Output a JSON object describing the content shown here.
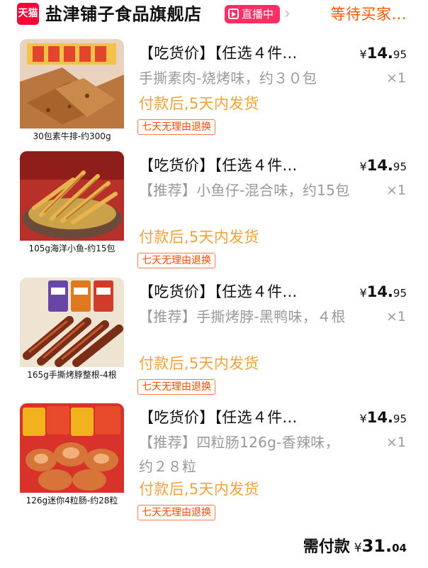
{
  "header": {
    "logo_text": "天猫",
    "store_name": "盐津铺子食品旗舰店",
    "live_label": "直播中",
    "chevron": "›",
    "status": "等待买家..."
  },
  "items": [
    {
      "title": "【吃货价】【任选４件...",
      "price_currency": "¥",
      "price_int": "14.",
      "price_dec": "95",
      "sku": "手撕素肉-烧烤味，约３０包",
      "qty": "×1",
      "ship": "付款后,5天内发货",
      "tag": "七天无理由退换",
      "image_caption": "30包素牛排-约300g"
    },
    {
      "title": "【吃货价】【任选４件...",
      "price_currency": "¥",
      "price_int": "14.",
      "price_dec": "95",
      "sku": "【推荐】小鱼仔-混合味，约15包",
      "qty": "×1",
      "ship": "付款后,5天内发货",
      "tag": "七天无理由退换",
      "image_caption": "105g海洋小鱼-约15包"
    },
    {
      "title": "【吃货价】【任选４件...",
      "price_currency": "¥",
      "price_int": "14.",
      "price_dec": "95",
      "sku": "【推荐】手撕烤脖-黑鸭味，４根",
      "qty": "×1",
      "ship": "付款后,5天内发货",
      "tag": "七天无理由退换",
      "image_caption": "165g手撕烤脖整根-4根"
    },
    {
      "title": "【吃货价】【任选４件...",
      "price_currency": "¥",
      "price_int": "14.",
      "price_dec": "95",
      "sku": "【推荐】四粒肠126g-香辣味，约２８粒",
      "qty": "×1",
      "ship": "付款后,5天内发货",
      "tag": "七天无理由退换",
      "image_caption": "126g迷你4粒肠-约28粒"
    }
  ],
  "footer": {
    "label": "需付款",
    "currency": "¥",
    "amount_int": "31.",
    "amount_dec": "04"
  },
  "colors": {
    "brand_red": "#ff0036",
    "live_pink": "#ff2e63",
    "status_orange": "#ff5500",
    "shipping_gold": "#f0a23a",
    "muted_gray": "#999999"
  }
}
